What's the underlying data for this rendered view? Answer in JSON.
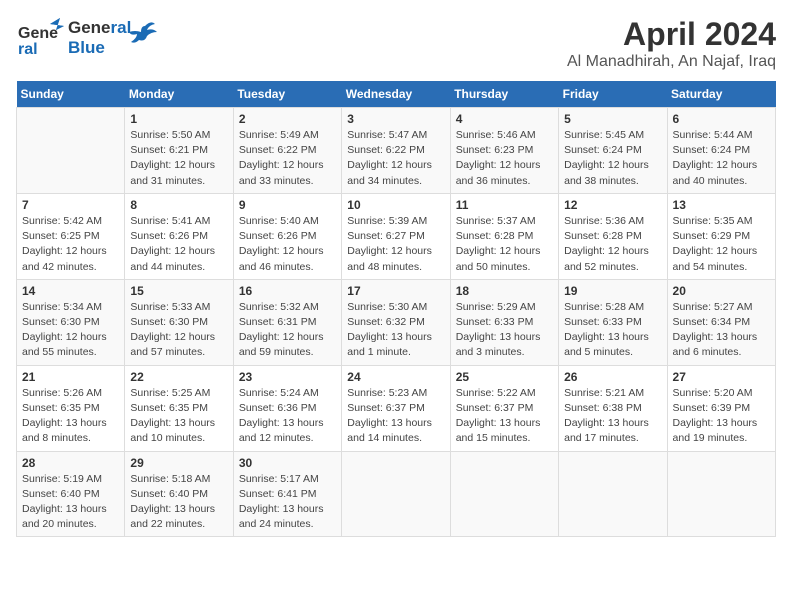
{
  "logo": {
    "line1": "General",
    "line2": "Blue"
  },
  "title": "April 2024",
  "subtitle": "Al Manadhirah, An Najaf, Iraq",
  "weekdays": [
    "Sunday",
    "Monday",
    "Tuesday",
    "Wednesday",
    "Thursday",
    "Friday",
    "Saturday"
  ],
  "weeks": [
    [
      {
        "num": "",
        "info": ""
      },
      {
        "num": "1",
        "info": "Sunrise: 5:50 AM\nSunset: 6:21 PM\nDaylight: 12 hours\nand 31 minutes."
      },
      {
        "num": "2",
        "info": "Sunrise: 5:49 AM\nSunset: 6:22 PM\nDaylight: 12 hours\nand 33 minutes."
      },
      {
        "num": "3",
        "info": "Sunrise: 5:47 AM\nSunset: 6:22 PM\nDaylight: 12 hours\nand 34 minutes."
      },
      {
        "num": "4",
        "info": "Sunrise: 5:46 AM\nSunset: 6:23 PM\nDaylight: 12 hours\nand 36 minutes."
      },
      {
        "num": "5",
        "info": "Sunrise: 5:45 AM\nSunset: 6:24 PM\nDaylight: 12 hours\nand 38 minutes."
      },
      {
        "num": "6",
        "info": "Sunrise: 5:44 AM\nSunset: 6:24 PM\nDaylight: 12 hours\nand 40 minutes."
      }
    ],
    [
      {
        "num": "7",
        "info": "Sunrise: 5:42 AM\nSunset: 6:25 PM\nDaylight: 12 hours\nand 42 minutes."
      },
      {
        "num": "8",
        "info": "Sunrise: 5:41 AM\nSunset: 6:26 PM\nDaylight: 12 hours\nand 44 minutes."
      },
      {
        "num": "9",
        "info": "Sunrise: 5:40 AM\nSunset: 6:26 PM\nDaylight: 12 hours\nand 46 minutes."
      },
      {
        "num": "10",
        "info": "Sunrise: 5:39 AM\nSunset: 6:27 PM\nDaylight: 12 hours\nand 48 minutes."
      },
      {
        "num": "11",
        "info": "Sunrise: 5:37 AM\nSunset: 6:28 PM\nDaylight: 12 hours\nand 50 minutes."
      },
      {
        "num": "12",
        "info": "Sunrise: 5:36 AM\nSunset: 6:28 PM\nDaylight: 12 hours\nand 52 minutes."
      },
      {
        "num": "13",
        "info": "Sunrise: 5:35 AM\nSunset: 6:29 PM\nDaylight: 12 hours\nand 54 minutes."
      }
    ],
    [
      {
        "num": "14",
        "info": "Sunrise: 5:34 AM\nSunset: 6:30 PM\nDaylight: 12 hours\nand 55 minutes."
      },
      {
        "num": "15",
        "info": "Sunrise: 5:33 AM\nSunset: 6:30 PM\nDaylight: 12 hours\nand 57 minutes."
      },
      {
        "num": "16",
        "info": "Sunrise: 5:32 AM\nSunset: 6:31 PM\nDaylight: 12 hours\nand 59 minutes."
      },
      {
        "num": "17",
        "info": "Sunrise: 5:30 AM\nSunset: 6:32 PM\nDaylight: 13 hours\nand 1 minute."
      },
      {
        "num": "18",
        "info": "Sunrise: 5:29 AM\nSunset: 6:33 PM\nDaylight: 13 hours\nand 3 minutes."
      },
      {
        "num": "19",
        "info": "Sunrise: 5:28 AM\nSunset: 6:33 PM\nDaylight: 13 hours\nand 5 minutes."
      },
      {
        "num": "20",
        "info": "Sunrise: 5:27 AM\nSunset: 6:34 PM\nDaylight: 13 hours\nand 6 minutes."
      }
    ],
    [
      {
        "num": "21",
        "info": "Sunrise: 5:26 AM\nSunset: 6:35 PM\nDaylight: 13 hours\nand 8 minutes."
      },
      {
        "num": "22",
        "info": "Sunrise: 5:25 AM\nSunset: 6:35 PM\nDaylight: 13 hours\nand 10 minutes."
      },
      {
        "num": "23",
        "info": "Sunrise: 5:24 AM\nSunset: 6:36 PM\nDaylight: 13 hours\nand 12 minutes."
      },
      {
        "num": "24",
        "info": "Sunrise: 5:23 AM\nSunset: 6:37 PM\nDaylight: 13 hours\nand 14 minutes."
      },
      {
        "num": "25",
        "info": "Sunrise: 5:22 AM\nSunset: 6:37 PM\nDaylight: 13 hours\nand 15 minutes."
      },
      {
        "num": "26",
        "info": "Sunrise: 5:21 AM\nSunset: 6:38 PM\nDaylight: 13 hours\nand 17 minutes."
      },
      {
        "num": "27",
        "info": "Sunrise: 5:20 AM\nSunset: 6:39 PM\nDaylight: 13 hours\nand 19 minutes."
      }
    ],
    [
      {
        "num": "28",
        "info": "Sunrise: 5:19 AM\nSunset: 6:40 PM\nDaylight: 13 hours\nand 20 minutes."
      },
      {
        "num": "29",
        "info": "Sunrise: 5:18 AM\nSunset: 6:40 PM\nDaylight: 13 hours\nand 22 minutes."
      },
      {
        "num": "30",
        "info": "Sunrise: 5:17 AM\nSunset: 6:41 PM\nDaylight: 13 hours\nand 24 minutes."
      },
      {
        "num": "",
        "info": ""
      },
      {
        "num": "",
        "info": ""
      },
      {
        "num": "",
        "info": ""
      },
      {
        "num": "",
        "info": ""
      }
    ]
  ]
}
